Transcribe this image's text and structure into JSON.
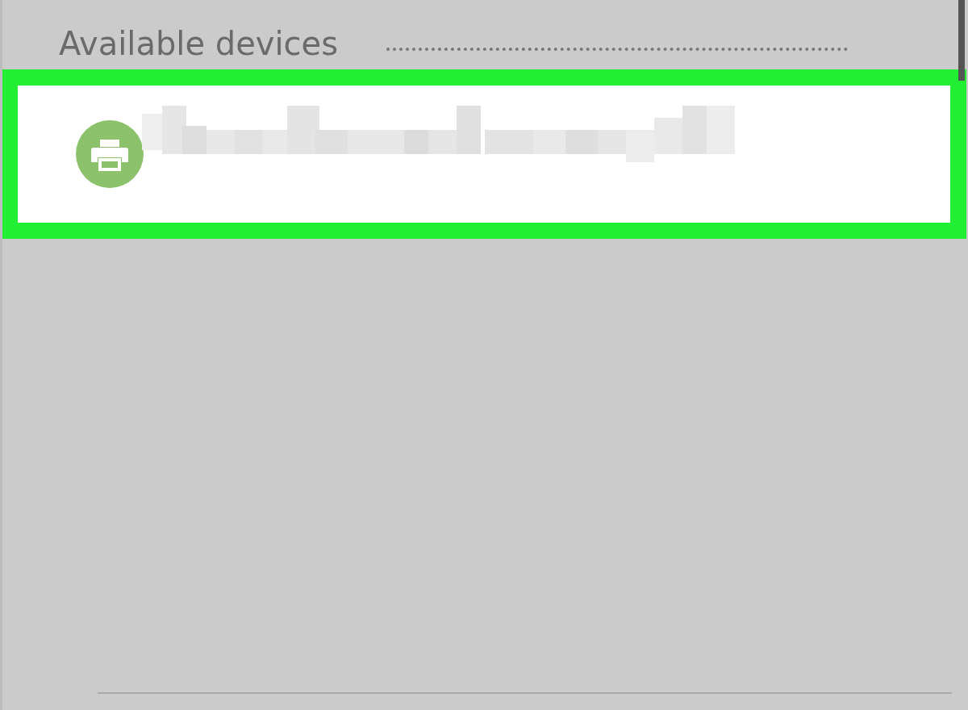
{
  "section": {
    "title": "Available devices"
  },
  "devices": [
    {
      "kind": "printer",
      "selected": true
    }
  ]
}
